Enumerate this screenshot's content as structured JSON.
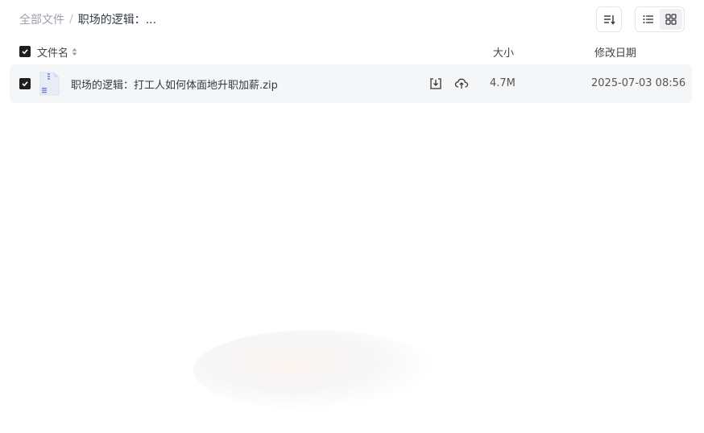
{
  "breadcrumb": {
    "root": "全部文件",
    "separator": "/",
    "current": "职场的逻辑：..."
  },
  "toolbar": {
    "sort_icon": "sort-icon",
    "view_list_icon": "list-view-icon",
    "view_grid_icon": "grid-view-icon"
  },
  "table": {
    "headers": {
      "name": "文件名",
      "size": "大小",
      "date": "修改日期"
    },
    "rows": [
      {
        "name": "职场的逻辑：打工人如何体面地升职加薪.zip",
        "size": "4.7M",
        "date": "2025-07-03 08:56",
        "checked": true
      }
    ]
  },
  "colors": {
    "checkbox": "#1f1f1f",
    "row_bg": "#f5f6f7",
    "breadcrumb_root": "#9aa0a8"
  }
}
